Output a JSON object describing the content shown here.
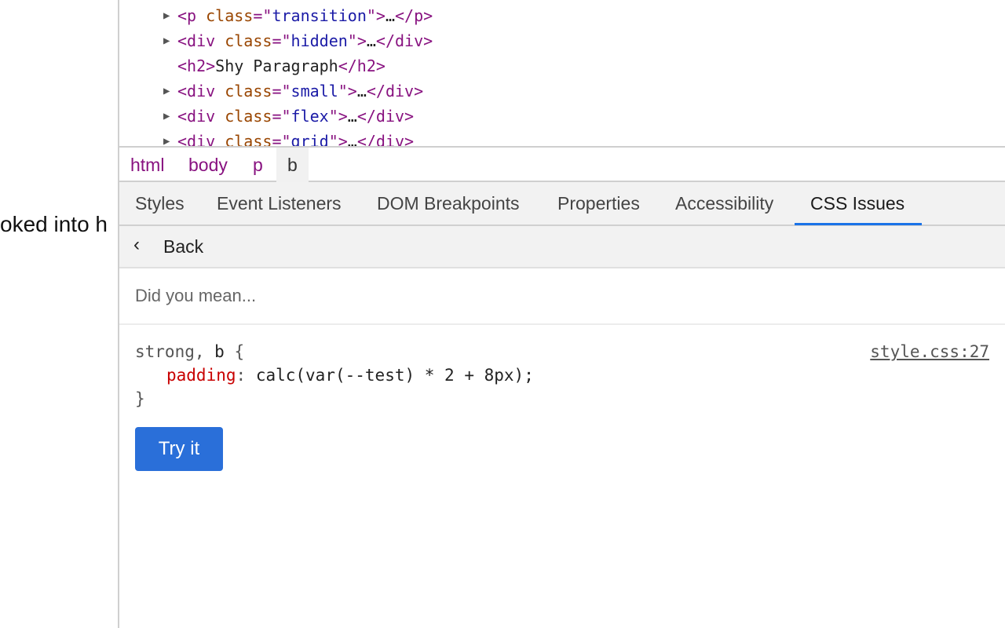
{
  "page": {
    "visible_text": "oked into h"
  },
  "dom_tree": {
    "lines": [
      {
        "expandable": true,
        "tag": "p",
        "attr": "class",
        "value": "transition",
        "ellipsis": "…",
        "close": "</p>"
      },
      {
        "expandable": true,
        "tag": "div",
        "attr": "class",
        "value": "hidden",
        "ellipsis": "…",
        "close": "</div>"
      },
      {
        "expandable": false,
        "open": "<h2>",
        "text": "Shy Paragraph",
        "close": "</h2>"
      },
      {
        "expandable": true,
        "tag": "div",
        "attr": "class",
        "value": "small",
        "ellipsis": "…",
        "close": "</div>"
      },
      {
        "expandable": true,
        "tag": "div",
        "attr": "class",
        "value": "flex",
        "ellipsis": "…",
        "close": "</div>"
      },
      {
        "expandable": true,
        "tag": "div",
        "attr": "class",
        "value": "grid",
        "ellipsis": "…",
        "close": "</div>"
      }
    ]
  },
  "breadcrumbs": [
    "html",
    "body",
    "p",
    "b"
  ],
  "tabs": [
    "Styles",
    "Event Listeners",
    "DOM Breakpoints",
    "Properties",
    "Accessibility",
    "CSS Issues"
  ],
  "active_tab": "CSS Issues",
  "back_label": "Back",
  "hint": "Did you mean...",
  "rule": {
    "selector_strong": "strong,",
    "selector_b": "b",
    "open_brace": "{",
    "property": "padding",
    "colon": ":",
    "value": "calc(var(--test) * 2 + 8px);",
    "close_brace": "}",
    "source": "style.css:27"
  },
  "try_button": "Try it",
  "colors": {
    "accent": "#1a73e8",
    "button": "#2a6fd9",
    "tag": "#881280",
    "attr_name": "#994500",
    "attr_value": "#1a1aa6",
    "property": "#c80000"
  }
}
